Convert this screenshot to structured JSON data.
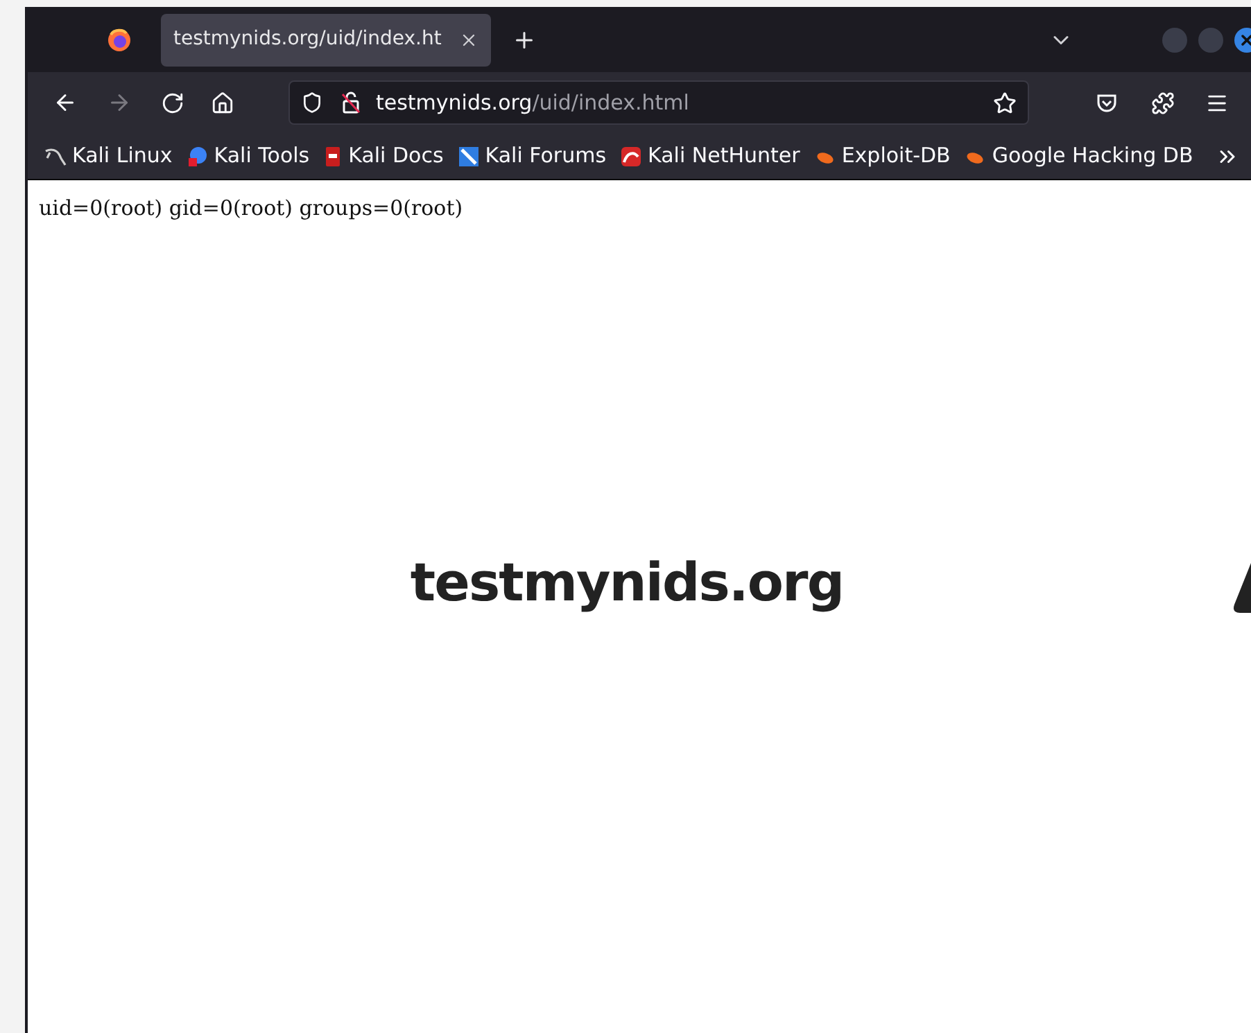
{
  "tabs": [
    {
      "title": "testmynids.org/uid/index.ht",
      "selected": true
    }
  ],
  "address_bar": {
    "host": "testmynids.org",
    "path": "/uid/index.html"
  },
  "bookmarks": [
    {
      "label": "Kali Linux"
    },
    {
      "label": "Kali Tools"
    },
    {
      "label": "Kali Docs"
    },
    {
      "label": "Kali Forums"
    },
    {
      "label": "Kali NetHunter"
    },
    {
      "label": "Exploit-DB"
    },
    {
      "label": "Google Hacking DB"
    }
  ],
  "page": {
    "output_line": "uid=0(root) gid=0(root) groups=0(root)",
    "heading": "testmynids.org"
  }
}
